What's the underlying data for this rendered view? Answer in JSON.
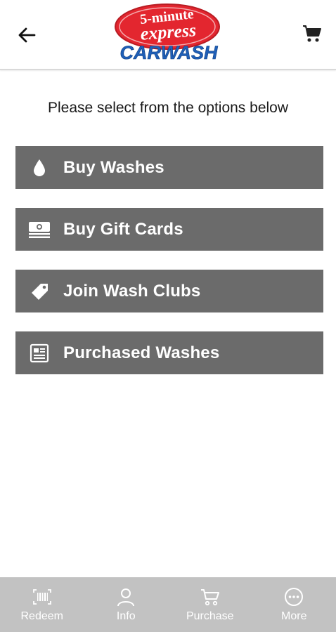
{
  "header": {
    "logo": {
      "line1": "5-minute",
      "line2": "express",
      "line3": "CARWASH"
    }
  },
  "prompt": "Please select from the options below",
  "menu": {
    "items": [
      {
        "label": "Buy Washes",
        "icon": "droplet-icon"
      },
      {
        "label": "Buy Gift Cards",
        "icon": "money-stack-icon"
      },
      {
        "label": "Join Wash Clubs",
        "icon": "tag-icon"
      },
      {
        "label": "Purchased Washes",
        "icon": "receipt-icon"
      }
    ]
  },
  "bottom_nav": {
    "items": [
      {
        "label": "Redeem",
        "icon": "barcode-icon"
      },
      {
        "label": "Info",
        "icon": "person-icon"
      },
      {
        "label": "Purchase",
        "icon": "cart-icon"
      },
      {
        "label": "More",
        "icon": "more-icon"
      }
    ]
  },
  "colors": {
    "menu_button": "#6b6b6b",
    "bottom_nav": "#c2c2c2",
    "logo_red": "#e3262f",
    "logo_blue": "#1f5fb7"
  }
}
